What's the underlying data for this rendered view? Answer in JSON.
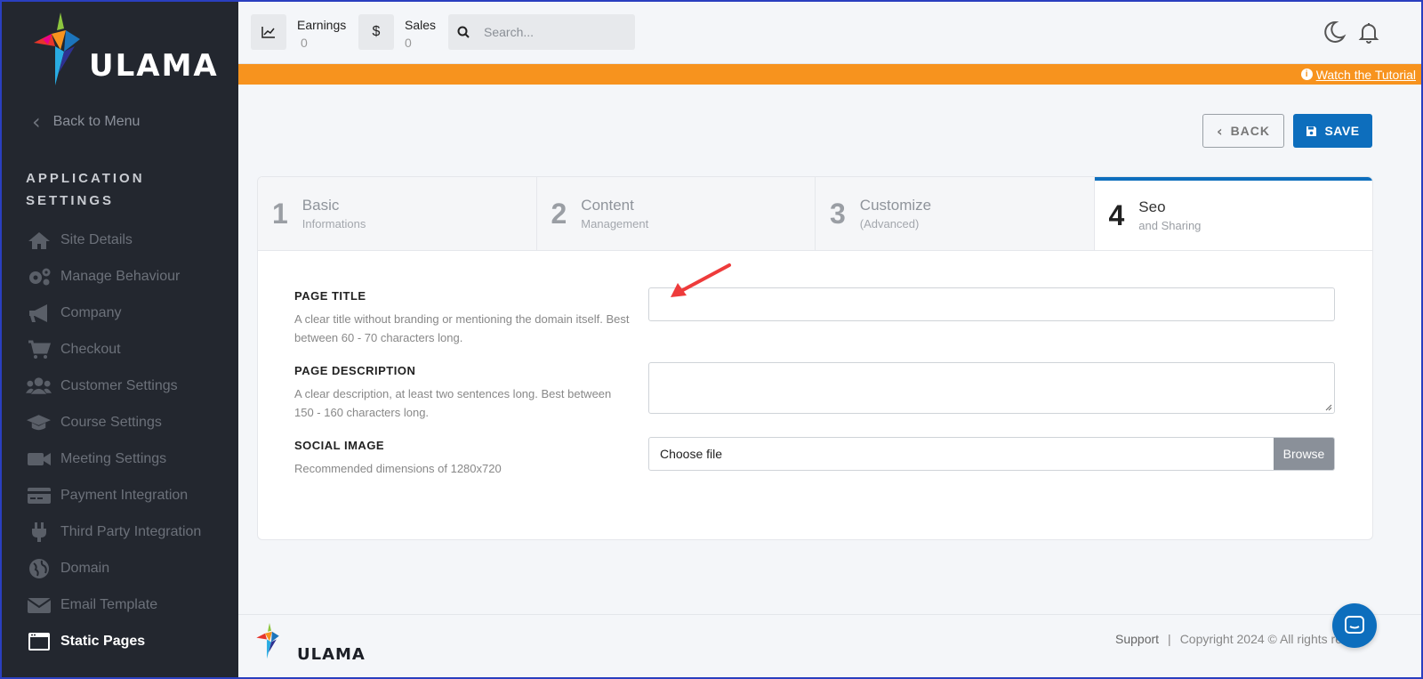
{
  "sidebar": {
    "brand": "ULAMA",
    "back_label": "Back to Menu",
    "section_title": "APPLICATION SETTINGS",
    "items": [
      {
        "label": "Site Details",
        "icon": "home-icon"
      },
      {
        "label": "Manage Behaviour",
        "icon": "gears-icon"
      },
      {
        "label": "Company",
        "icon": "megaphone-icon"
      },
      {
        "label": "Checkout",
        "icon": "cart-icon"
      },
      {
        "label": "Customer Settings",
        "icon": "users-icon"
      },
      {
        "label": "Course Settings",
        "icon": "graduation-cap-icon"
      },
      {
        "label": "Meeting Settings",
        "icon": "video-camera-icon"
      },
      {
        "label": "Payment Integration",
        "icon": "credit-card-icon"
      },
      {
        "label": "Third Party Integration",
        "icon": "plug-icon"
      },
      {
        "label": "Domain",
        "icon": "globe-icon"
      },
      {
        "label": "Email Template",
        "icon": "envelope-icon"
      },
      {
        "label": "Static Pages",
        "icon": "window-icon",
        "active": true
      }
    ]
  },
  "topbar": {
    "earnings_label": "Earnings",
    "earnings_value": "0",
    "sales_label": "Sales",
    "sales_value": "0",
    "search_placeholder": "Search..."
  },
  "banner": {
    "link_label": "Watch the Tutorial",
    "color": "#f7931e"
  },
  "actions": {
    "back_label": "BACK",
    "save_label": "SAVE"
  },
  "steps": [
    {
      "number": "1",
      "title": "Basic",
      "subtitle": "Informations"
    },
    {
      "number": "2",
      "title": "Content",
      "subtitle": "Management"
    },
    {
      "number": "3",
      "title": "Customize",
      "subtitle": "(Advanced)"
    },
    {
      "number": "4",
      "title": "Seo",
      "subtitle": "and Sharing",
      "active": true
    }
  ],
  "form": {
    "page_title_label": "PAGE TITLE",
    "page_title_help": "A clear title without branding or mentioning the domain itself. Best between 60 - 70 characters long.",
    "page_title_value": "",
    "page_description_label": "PAGE DESCRIPTION",
    "page_description_help": "A clear description, at least two sentences long. Best between 150 - 160 characters long.",
    "page_description_value": "",
    "social_image_label": "SOCIAL IMAGE",
    "social_image_help": "Recommended dimensions of 1280x720",
    "file_placeholder": "Choose file",
    "browse_label": "Browse"
  },
  "footer": {
    "brand": "ULAMA",
    "support_label": "Support",
    "separator": "|",
    "copyright": "Copyright 2024 © All rights res"
  },
  "colors": {
    "accent": "#0d6ebd",
    "sidebar_bg": "#23272f",
    "annotation_arrow": "#ee3b3b"
  }
}
